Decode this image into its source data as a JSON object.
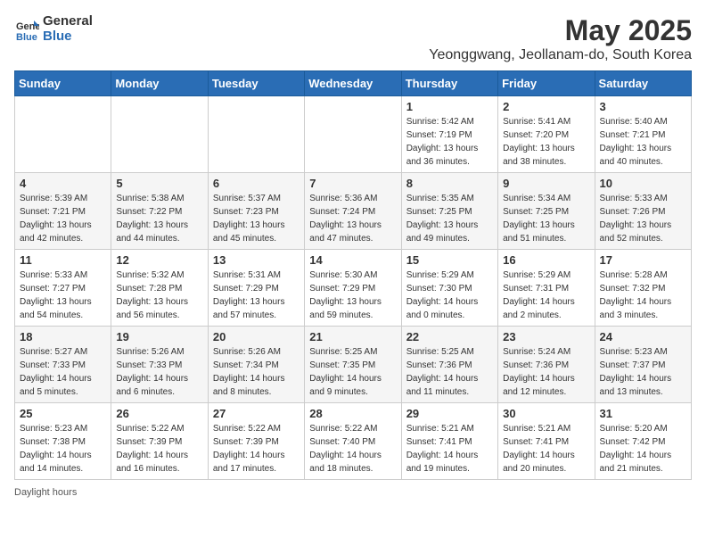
{
  "logo": {
    "general": "General",
    "blue": "Blue"
  },
  "title": "May 2025",
  "subtitle": "Yeonggwang, Jeollanam-do, South Korea",
  "days": [
    "Sunday",
    "Monday",
    "Tuesday",
    "Wednesday",
    "Thursday",
    "Friday",
    "Saturday"
  ],
  "weeks": [
    [
      {
        "date": "",
        "sunrise": "",
        "sunset": "",
        "daylight": ""
      },
      {
        "date": "",
        "sunrise": "",
        "sunset": "",
        "daylight": ""
      },
      {
        "date": "",
        "sunrise": "",
        "sunset": "",
        "daylight": ""
      },
      {
        "date": "",
        "sunrise": "",
        "sunset": "",
        "daylight": ""
      },
      {
        "date": "1",
        "sunrise": "Sunrise: 5:42 AM",
        "sunset": "Sunset: 7:19 PM",
        "daylight": "Daylight: 13 hours and 36 minutes."
      },
      {
        "date": "2",
        "sunrise": "Sunrise: 5:41 AM",
        "sunset": "Sunset: 7:20 PM",
        "daylight": "Daylight: 13 hours and 38 minutes."
      },
      {
        "date": "3",
        "sunrise": "Sunrise: 5:40 AM",
        "sunset": "Sunset: 7:21 PM",
        "daylight": "Daylight: 13 hours and 40 minutes."
      }
    ],
    [
      {
        "date": "4",
        "sunrise": "Sunrise: 5:39 AM",
        "sunset": "Sunset: 7:21 PM",
        "daylight": "Daylight: 13 hours and 42 minutes."
      },
      {
        "date": "5",
        "sunrise": "Sunrise: 5:38 AM",
        "sunset": "Sunset: 7:22 PM",
        "daylight": "Daylight: 13 hours and 44 minutes."
      },
      {
        "date": "6",
        "sunrise": "Sunrise: 5:37 AM",
        "sunset": "Sunset: 7:23 PM",
        "daylight": "Daylight: 13 hours and 45 minutes."
      },
      {
        "date": "7",
        "sunrise": "Sunrise: 5:36 AM",
        "sunset": "Sunset: 7:24 PM",
        "daylight": "Daylight: 13 hours and 47 minutes."
      },
      {
        "date": "8",
        "sunrise": "Sunrise: 5:35 AM",
        "sunset": "Sunset: 7:25 PM",
        "daylight": "Daylight: 13 hours and 49 minutes."
      },
      {
        "date": "9",
        "sunrise": "Sunrise: 5:34 AM",
        "sunset": "Sunset: 7:25 PM",
        "daylight": "Daylight: 13 hours and 51 minutes."
      },
      {
        "date": "10",
        "sunrise": "Sunrise: 5:33 AM",
        "sunset": "Sunset: 7:26 PM",
        "daylight": "Daylight: 13 hours and 52 minutes."
      }
    ],
    [
      {
        "date": "11",
        "sunrise": "Sunrise: 5:33 AM",
        "sunset": "Sunset: 7:27 PM",
        "daylight": "Daylight: 13 hours and 54 minutes."
      },
      {
        "date": "12",
        "sunrise": "Sunrise: 5:32 AM",
        "sunset": "Sunset: 7:28 PM",
        "daylight": "Daylight: 13 hours and 56 minutes."
      },
      {
        "date": "13",
        "sunrise": "Sunrise: 5:31 AM",
        "sunset": "Sunset: 7:29 PM",
        "daylight": "Daylight: 13 hours and 57 minutes."
      },
      {
        "date": "14",
        "sunrise": "Sunrise: 5:30 AM",
        "sunset": "Sunset: 7:29 PM",
        "daylight": "Daylight: 13 hours and 59 minutes."
      },
      {
        "date": "15",
        "sunrise": "Sunrise: 5:29 AM",
        "sunset": "Sunset: 7:30 PM",
        "daylight": "Daylight: 14 hours and 0 minutes."
      },
      {
        "date": "16",
        "sunrise": "Sunrise: 5:29 AM",
        "sunset": "Sunset: 7:31 PM",
        "daylight": "Daylight: 14 hours and 2 minutes."
      },
      {
        "date": "17",
        "sunrise": "Sunrise: 5:28 AM",
        "sunset": "Sunset: 7:32 PM",
        "daylight": "Daylight: 14 hours and 3 minutes."
      }
    ],
    [
      {
        "date": "18",
        "sunrise": "Sunrise: 5:27 AM",
        "sunset": "Sunset: 7:33 PM",
        "daylight": "Daylight: 14 hours and 5 minutes."
      },
      {
        "date": "19",
        "sunrise": "Sunrise: 5:26 AM",
        "sunset": "Sunset: 7:33 PM",
        "daylight": "Daylight: 14 hours and 6 minutes."
      },
      {
        "date": "20",
        "sunrise": "Sunrise: 5:26 AM",
        "sunset": "Sunset: 7:34 PM",
        "daylight": "Daylight: 14 hours and 8 minutes."
      },
      {
        "date": "21",
        "sunrise": "Sunrise: 5:25 AM",
        "sunset": "Sunset: 7:35 PM",
        "daylight": "Daylight: 14 hours and 9 minutes."
      },
      {
        "date": "22",
        "sunrise": "Sunrise: 5:25 AM",
        "sunset": "Sunset: 7:36 PM",
        "daylight": "Daylight: 14 hours and 11 minutes."
      },
      {
        "date": "23",
        "sunrise": "Sunrise: 5:24 AM",
        "sunset": "Sunset: 7:36 PM",
        "daylight": "Daylight: 14 hours and 12 minutes."
      },
      {
        "date": "24",
        "sunrise": "Sunrise: 5:23 AM",
        "sunset": "Sunset: 7:37 PM",
        "daylight": "Daylight: 14 hours and 13 minutes."
      }
    ],
    [
      {
        "date": "25",
        "sunrise": "Sunrise: 5:23 AM",
        "sunset": "Sunset: 7:38 PM",
        "daylight": "Daylight: 14 hours and 14 minutes."
      },
      {
        "date": "26",
        "sunrise": "Sunrise: 5:22 AM",
        "sunset": "Sunset: 7:39 PM",
        "daylight": "Daylight: 14 hours and 16 minutes."
      },
      {
        "date": "27",
        "sunrise": "Sunrise: 5:22 AM",
        "sunset": "Sunset: 7:39 PM",
        "daylight": "Daylight: 14 hours and 17 minutes."
      },
      {
        "date": "28",
        "sunrise": "Sunrise: 5:22 AM",
        "sunset": "Sunset: 7:40 PM",
        "daylight": "Daylight: 14 hours and 18 minutes."
      },
      {
        "date": "29",
        "sunrise": "Sunrise: 5:21 AM",
        "sunset": "Sunset: 7:41 PM",
        "daylight": "Daylight: 14 hours and 19 minutes."
      },
      {
        "date": "30",
        "sunrise": "Sunrise: 5:21 AM",
        "sunset": "Sunset: 7:41 PM",
        "daylight": "Daylight: 14 hours and 20 minutes."
      },
      {
        "date": "31",
        "sunrise": "Sunrise: 5:20 AM",
        "sunset": "Sunset: 7:42 PM",
        "daylight": "Daylight: 14 hours and 21 minutes."
      }
    ]
  ],
  "footer": {
    "daylight_label": "Daylight hours"
  }
}
